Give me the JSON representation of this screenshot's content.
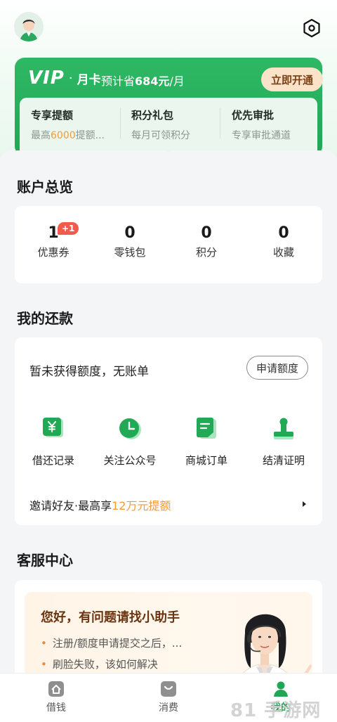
{
  "header": {
    "avatar_icon": "user-avatar",
    "settings_icon": "hexagon-settings-icon"
  },
  "vip": {
    "logo_vip": "VIP",
    "logo_dot": "·",
    "logo_card": "月卡",
    "save_prefix": "预计省",
    "save_amount": "684元",
    "save_suffix": "/月",
    "open_button": "立即开通",
    "benefits": [
      {
        "title": "专享提额",
        "sub_prefix": "最高",
        "sub_highlight": "6000",
        "sub_suffix": "提额..."
      },
      {
        "title": "积分礼包",
        "sub": "每月可领积分"
      },
      {
        "title": "优先审批",
        "sub": "专享审批通道"
      }
    ]
  },
  "overview": {
    "title": "账户总览",
    "badge": "+1",
    "stats": [
      {
        "value": "1",
        "label": "优惠券"
      },
      {
        "value": "0",
        "label": "零钱包"
      },
      {
        "value": "0",
        "label": "积分"
      },
      {
        "value": "0",
        "label": "收藏"
      }
    ]
  },
  "repay": {
    "title": "我的还款",
    "status_text": "暂未获得额度，无账单",
    "apply_button": "申请额度",
    "tools": [
      {
        "icon": "yen-card-icon",
        "label": "借还记录"
      },
      {
        "icon": "clock-icon",
        "label": "关注公众号"
      },
      {
        "icon": "order-doc-icon",
        "label": "商城订单"
      },
      {
        "icon": "stamp-icon",
        "label": "结清证明"
      }
    ],
    "invite_prefix": "邀请好友·最高享",
    "invite_highlight": "12万元提额"
  },
  "service": {
    "title": "客服中心",
    "helper_title": "您好，有问题请找小助手",
    "items": [
      "注册/额度申请提交之后，...",
      "刷脸失败，该如何解决"
    ]
  },
  "tabbar": {
    "tabs": [
      {
        "label": "借钱",
        "icon": "home-icon",
        "active": false
      },
      {
        "label": "消费",
        "icon": "shopping-bag-icon",
        "active": false
      },
      {
        "label": "我的",
        "icon": "person-icon",
        "active": true
      }
    ]
  },
  "watermark": "81 手游网",
  "colors": {
    "primary": "#1fa756",
    "accent_orange": "#f39a3b",
    "badge_red": "#f15b4c"
  }
}
